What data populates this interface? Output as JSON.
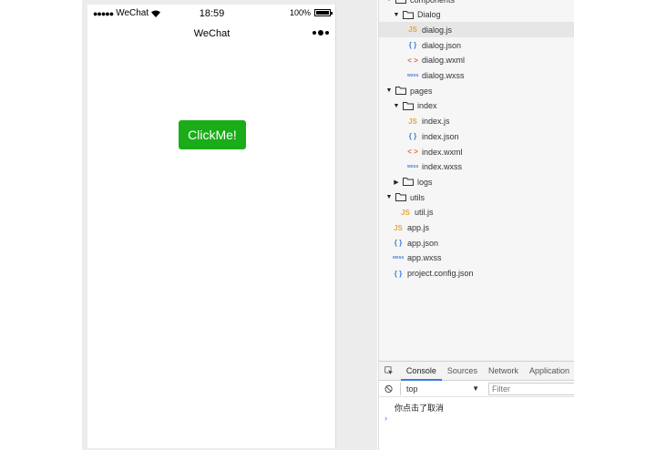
{
  "simulator": {
    "carrier": "WeChat",
    "time": "18:59",
    "battery": "100%",
    "nav_title": "WeChat",
    "button_label": "ClickMe!",
    "button_color": "#1aad19"
  },
  "tree": [
    {
      "type": "folder",
      "expanded": true,
      "label": "components"
    },
    {
      "type": "folder",
      "expanded": true,
      "label": "Dialog"
    },
    {
      "type": "file",
      "icon": "js",
      "label": "dialog.js",
      "selected": true
    },
    {
      "type": "file",
      "icon": "json",
      "label": "dialog.json"
    },
    {
      "type": "file",
      "icon": "wxml",
      "label": "dialog.wxml"
    },
    {
      "type": "file",
      "icon": "wxss",
      "label": "dialog.wxss"
    },
    {
      "type": "folder",
      "expanded": true,
      "label": "pages"
    },
    {
      "type": "folder",
      "expanded": true,
      "label": "index"
    },
    {
      "type": "file",
      "icon": "js",
      "label": "index.js"
    },
    {
      "type": "file",
      "icon": "json",
      "label": "index.json"
    },
    {
      "type": "file",
      "icon": "wxml",
      "label": "index.wxml"
    },
    {
      "type": "file",
      "icon": "wxss",
      "label": "index.wxss"
    },
    {
      "type": "folder",
      "expanded": false,
      "label": "logs"
    },
    {
      "type": "folder",
      "expanded": true,
      "label": "utils"
    },
    {
      "type": "file",
      "icon": "js",
      "label": "util.js"
    },
    {
      "type": "file",
      "icon": "js",
      "label": "app.js"
    },
    {
      "type": "file",
      "icon": "json",
      "label": "app.json"
    },
    {
      "type": "file",
      "icon": "wxss",
      "label": "app.wxss"
    },
    {
      "type": "file",
      "icon": "json",
      "label": "project.config.json"
    }
  ],
  "icon_glyphs": {
    "js": "JS",
    "json": "{ }",
    "wxml": "< >",
    "wxss": "wxss"
  },
  "devtools": {
    "tabs": [
      "Console",
      "Sources",
      "Network",
      "Application"
    ],
    "active_tab": "Console",
    "context": "top",
    "filter_placeholder": "Filter",
    "log": "你点击了取消",
    "prompt": "›"
  }
}
